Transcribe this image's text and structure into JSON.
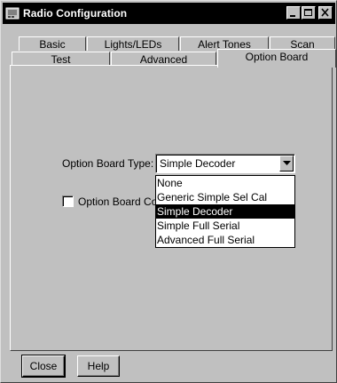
{
  "window": {
    "title": "Radio Configuration",
    "controls": [
      "minimize",
      "maximize",
      "close"
    ]
  },
  "tabs": {
    "row1": [
      "Basic",
      "Lights/LEDs",
      "Alert Tones",
      "Scan"
    ],
    "row2": [
      "Test",
      "Advanced",
      "Option Board"
    ],
    "active": "Option Board"
  },
  "option_board": {
    "type_label": "Option Board Type:",
    "type_value": "Simple Decoder",
    "options": [
      "None",
      "Generic Simple Sel Cal",
      "Simple Decoder",
      "Simple Full Serial",
      "Advanced Full Serial"
    ],
    "selected_index": 2,
    "checkbox_label": "Option Board Conf",
    "checkbox_checked": false
  },
  "footer": {
    "close_label": "Close",
    "help_label": "Help"
  }
}
